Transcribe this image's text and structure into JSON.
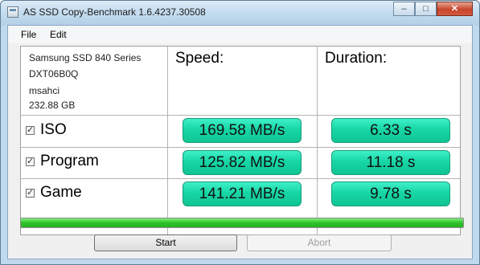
{
  "window": {
    "title": "AS SSD Copy-Benchmark 1.6.4237.30508",
    "controls": {
      "minimize": "–",
      "maximize": "□",
      "close": "✕"
    }
  },
  "menu": [
    {
      "label": "File"
    },
    {
      "label": "Edit"
    }
  ],
  "drive": {
    "model": "Samsung SSD 840 Series",
    "firmware": "DXT06B0Q",
    "driver": "msahci",
    "capacity": "232.88 GB"
  },
  "headers": {
    "speed": "Speed:",
    "duration": "Duration:"
  },
  "rows": [
    {
      "label": "ISO",
      "checked": true,
      "speed": "169.58 MB/s",
      "duration": "6.33 s"
    },
    {
      "label": "Program",
      "checked": true,
      "speed": "125.82 MB/s",
      "duration": "11.18 s"
    },
    {
      "label": "Game",
      "checked": true,
      "speed": "141.21 MB/s",
      "duration": "9.78 s"
    }
  ],
  "progress": {
    "value_percent": 100,
    "color": "#2fc12a"
  },
  "buttons": {
    "start": "Start",
    "abort": "Abort",
    "abort_disabled": true
  },
  "colors": {
    "result_fill": "#17d6a6",
    "titlebar": "#c4dcef"
  },
  "icons": {
    "app": "app-window-icon",
    "checkbox": "checkmark-icon"
  }
}
